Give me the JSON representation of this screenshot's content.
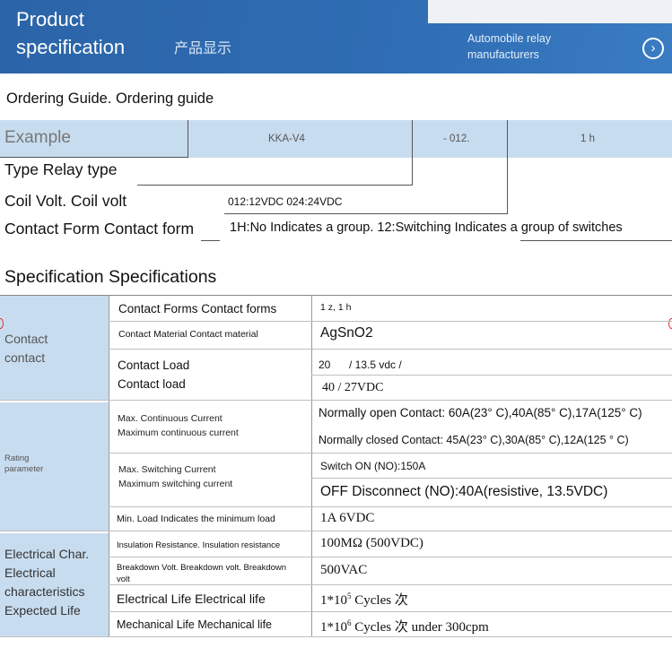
{
  "header": {
    "title_line1": "Product",
    "title_line2": "specification",
    "cn": "产品显示",
    "sub_line1": "Automobile relay",
    "sub_line2": "manufacturers",
    "arrow": "›"
  },
  "ordering": {
    "title": "Ordering Guide. Ordering guide",
    "example_label": "Example",
    "code1": "KKA-V4",
    "code2": "- 012.",
    "code3": "1 h",
    "type_label": "Type Relay type",
    "coil_label": "Coil Volt. Coil volt",
    "coil_value": "012:12VDC 024:24VDC",
    "contact_label": "Contact Form Contact form",
    "contact_value": "1H:No Indicates a group. 12:Switching Indicates a group of switches"
  },
  "spec": {
    "title": "Specification Specifications",
    "cat_contact": [
      "Contact",
      "contact"
    ],
    "cat_rating": [
      "Rating",
      "parameter"
    ],
    "cat_elec": [
      "Electrical Char.",
      "Electrical",
      "characteristics",
      "Expected Life"
    ],
    "rows": {
      "contact_forms": "Contact Forms Contact forms",
      "contact_forms_val": "1 z, 1 h",
      "contact_material": "Contact Material Contact material",
      "contact_material_val": "AgSnO2",
      "contact_load_1": "Contact Load",
      "contact_load_2": "Contact load",
      "contact_load_val1a": "20",
      "contact_load_val1b": "/ 13.5 vdc /",
      "contact_load_val2": "40 / 27VDC",
      "max_cont_1": "Max. Continuous Current",
      "max_cont_2": "Maximum continuous current",
      "max_cont_val1": "Normally open Contact: 60A(23° C),40A(85° C),17A(125° C)",
      "max_cont_val2": "Normally closed Contact: 45A(23° C),30A(85° C),12A(125 ° C)",
      "max_sw_1": "Max. Switching Current",
      "max_sw_2": "Maximum switching current",
      "max_sw_val1": "Switch ON (NO):150A",
      "max_sw_val2": "OFF Disconnect (NO):40A(resistive, 13.5VDC)",
      "min_load": "Min. Load Indicates the minimum load",
      "min_load_val": "1A 6VDC",
      "insulation": "Insulation Resistance. Insulation resistance",
      "insulation_val": "100MΩ (500VDC)",
      "breakdown": "Breakdown Volt. Breakdown volt. Breakdown volt",
      "breakdown_val": "500VAC",
      "elec_life": "Electrical Life Electrical life",
      "elec_life_val_a": "1*10",
      "elec_life_exp": "5",
      "elec_life_val_b": "Cycles 次",
      "mech_life": "Mechanical Life Mechanical life",
      "mech_life_val_a": "1*10",
      "mech_life_exp": "6",
      "mech_life_val_b": "Cycles 次 under 300cpm"
    }
  }
}
